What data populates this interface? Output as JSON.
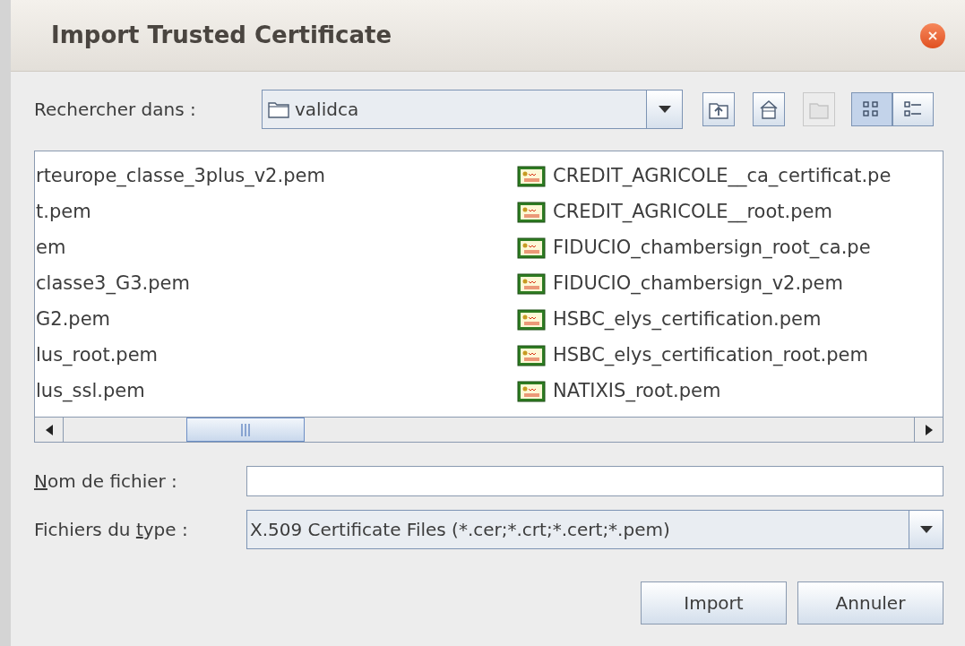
{
  "window": {
    "title": "Import Trusted Certificate"
  },
  "look_in": {
    "label": "Rechercher dans :",
    "value": "validca"
  },
  "toolbar_buttons": [
    {
      "kind": "up",
      "disabled": false
    },
    {
      "kind": "home",
      "disabled": false
    },
    {
      "kind": "new_folder",
      "disabled": true
    }
  ],
  "view_toggles": [
    {
      "kind": "list",
      "selected": true
    },
    {
      "kind": "details",
      "selected": false
    }
  ],
  "file_list": {
    "columns": [
      {
        "icons_visible": false,
        "files": [
          "rteurope_classe_3plus_v2.pem",
          "t.pem",
          "em",
          "classe3_G3.pem",
          "G2.pem",
          "lus_root.pem",
          "lus_ssl.pem"
        ]
      },
      {
        "icons_visible": true,
        "files": [
          "CREDIT_AGRICOLE__ca_certificat.pe",
          "CREDIT_AGRICOLE__root.pem",
          "FIDUCIO_chambersign_root_ca.pe",
          "FIDUCIO_chambersign_v2.pem",
          "HSBC_elys_certification.pem",
          "HSBC_elys_certification_root.pem",
          "NATIXIS_root.pem"
        ]
      }
    ]
  },
  "file_name": {
    "label_key": "N",
    "label_after": "om de fichier :"
  },
  "file_type": {
    "label_before": "Fichiers du ",
    "label_key": "t",
    "label_after": "ype :",
    "value": "X.509 Certificate Files (*.cer;*.crt;*.cert;*.pem)"
  },
  "buttons": [
    "Import",
    "Annuler"
  ]
}
